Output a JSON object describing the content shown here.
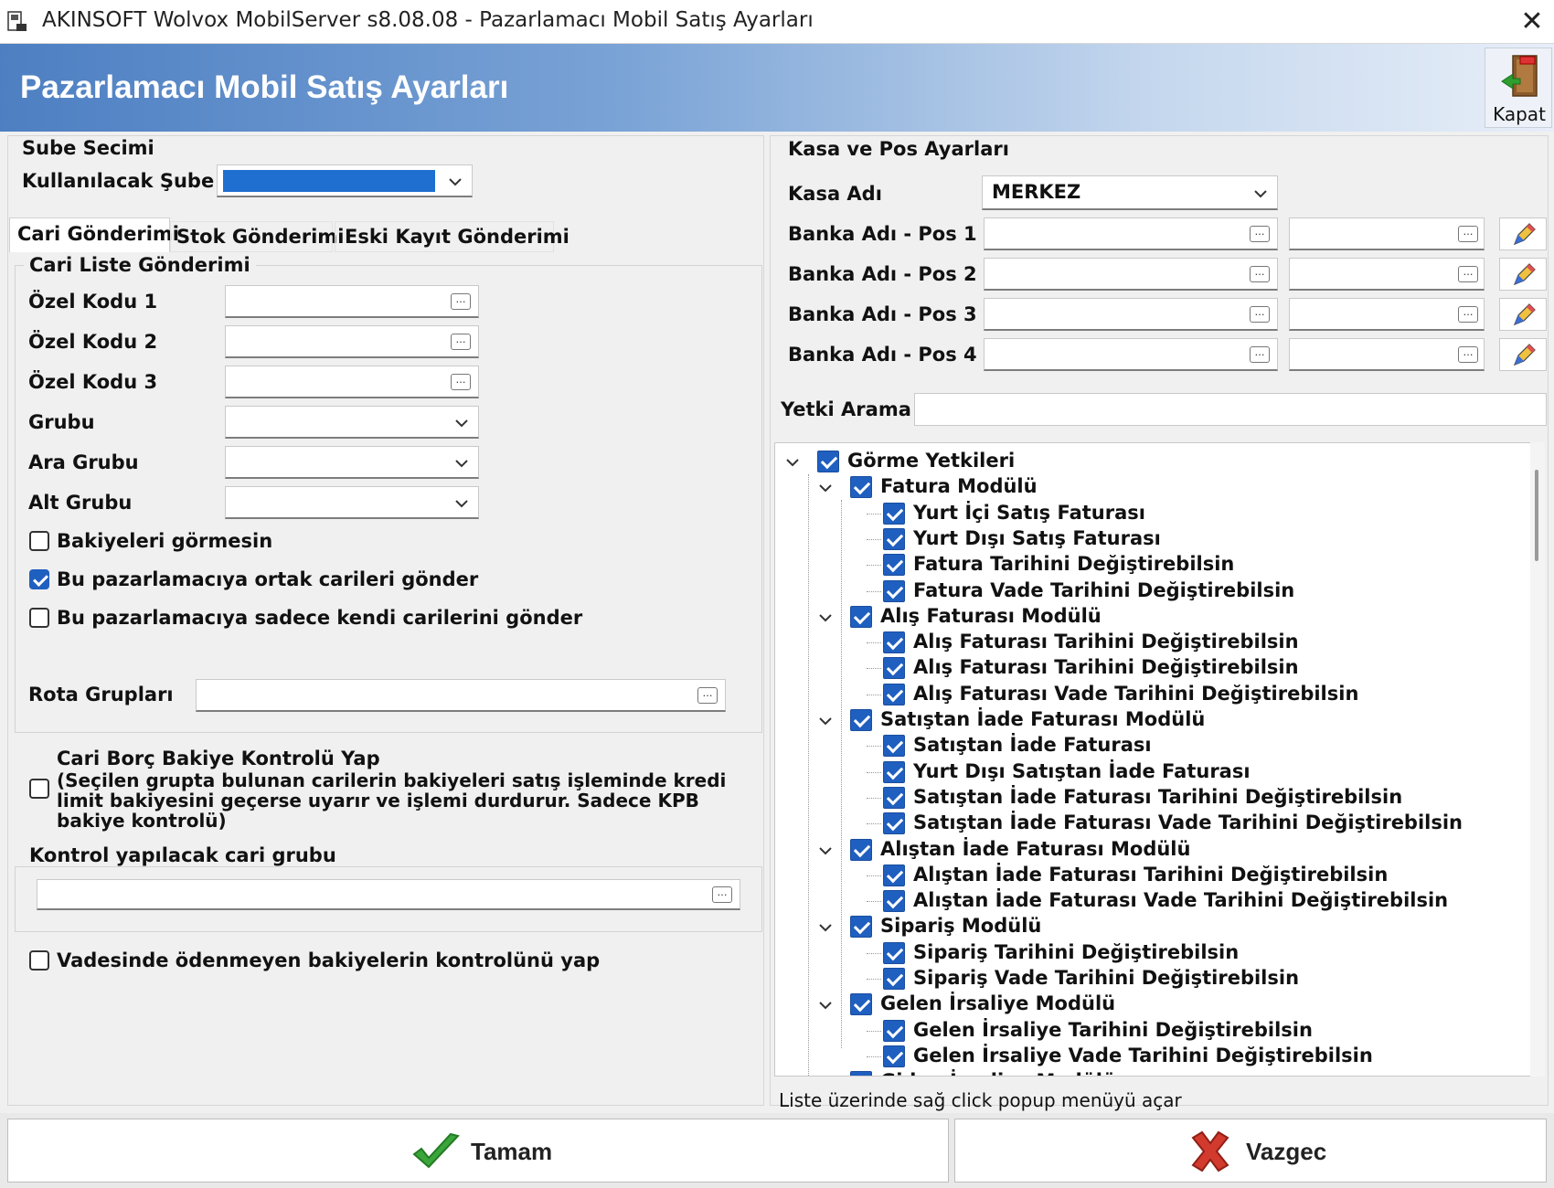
{
  "window": {
    "title": "AKINSOFT Wolvox MobilServer s8.08.08 - Pazarlamacı Mobil Satış Ayarları",
    "close_glyph": "✕"
  },
  "header": {
    "title": "Pazarlamacı Mobil Satış Ayarları",
    "close_button_label": "Kapat",
    "close_icon": "exit-door-icon"
  },
  "branch": {
    "section_title": "Sube Secimi",
    "label": "Kullanılacak Şube",
    "selected_value": ""
  },
  "tabs": [
    {
      "label": "Cari Gönderimi",
      "active": true
    },
    {
      "label": "Stok Gönderimi",
      "active": false
    },
    {
      "label": "Eski Kayıt Gönderimi",
      "active": false
    }
  ],
  "cari_list": {
    "group_title": "Cari Liste Gönderimi",
    "fields": [
      {
        "label": "Özel Kodu 1",
        "value": "",
        "kind": "lookup"
      },
      {
        "label": "Özel Kodu 2",
        "value": "",
        "kind": "lookup"
      },
      {
        "label": "Özel Kodu 3",
        "value": "",
        "kind": "lookup"
      },
      {
        "label": "Grubu",
        "value": "",
        "kind": "dropdown"
      },
      {
        "label": "Ara Grubu",
        "value": "",
        "kind": "dropdown"
      },
      {
        "label": "Alt Grubu",
        "value": "",
        "kind": "dropdown"
      }
    ],
    "checkboxes": [
      {
        "label": "Bakiyeleri görmesin",
        "checked": false
      },
      {
        "label": "Bu pazarlamacıya ortak carileri gönder",
        "checked": true
      },
      {
        "label": "Bu pazarlamacıya sadece kendi carilerini gönder",
        "checked": false
      }
    ],
    "route_label": "Rota Grupları",
    "route_value": ""
  },
  "debt_control": {
    "checked": false,
    "line1": "Cari Borç Bakiye Kontrolü Yap",
    "line2": "(Seçilen grupta bulunan carilerin bakiyeleri satış işleminde kredi",
    "line3": "limit bakiyesini geçerse uyarır ve işlemi durdurur. Sadece KPB",
    "line4": "bakiye kontrolü)",
    "group_title": "Kontrol yapılacak cari grubu",
    "group_value": ""
  },
  "overdue": {
    "label": "Vadesinde ödenmeyen bakiyelerin kontrolünü yap",
    "checked": false
  },
  "kasa_pos": {
    "section_title": "Kasa ve Pos Ayarları",
    "kasa_label": "Kasa Adı",
    "kasa_value": "MERKEZ",
    "pos_rows": [
      {
        "label": "Banka Adı - Pos 1",
        "bank": "",
        "pos": ""
      },
      {
        "label": "Banka Adı - Pos 2",
        "bank": "",
        "pos": ""
      },
      {
        "label": "Banka Adı - Pos 3",
        "bank": "",
        "pos": ""
      },
      {
        "label": "Banka Adı - Pos 4",
        "bank": "",
        "pos": ""
      }
    ]
  },
  "permission_search": {
    "label": "Yetki Arama",
    "value": ""
  },
  "tree": [
    {
      "level": 0,
      "label": "Görme Yetkileri",
      "expandable": true
    },
    {
      "level": 1,
      "label": "Fatura Modülü",
      "expandable": true
    },
    {
      "level": 2,
      "label": "Yurt İçi Satış Faturası"
    },
    {
      "level": 2,
      "label": "Yurt Dışı Satış Faturası"
    },
    {
      "level": 2,
      "label": "Fatura Tarihini Değiştirebilsin"
    },
    {
      "level": 2,
      "label": "Fatura Vade Tarihini Değiştirebilsin"
    },
    {
      "level": 1,
      "label": "Alış Faturası Modülü",
      "expandable": true
    },
    {
      "level": 2,
      "label": "Alış Faturası Tarihini Değiştirebilsin"
    },
    {
      "level": 2,
      "label": "Alış Faturası Tarihini Değiştirebilsin"
    },
    {
      "level": 2,
      "label": "Alış Faturası Vade Tarihini Değiştirebilsin"
    },
    {
      "level": 1,
      "label": "Satıştan İade Faturası Modülü",
      "expandable": true
    },
    {
      "level": 2,
      "label": "Satıştan İade Faturası"
    },
    {
      "level": 2,
      "label": "Yurt Dışı Satıştan İade Faturası"
    },
    {
      "level": 2,
      "label": "Satıştan İade Faturası Tarihini Değiştirebilsin"
    },
    {
      "level": 2,
      "label": "Satıştan İade Faturası Vade Tarihini Değiştirebilsin"
    },
    {
      "level": 1,
      "label": "Alıştan İade Faturası Modülü",
      "expandable": true
    },
    {
      "level": 2,
      "label": "Alıştan İade Faturası Tarihini Değiştirebilsin"
    },
    {
      "level": 2,
      "label": "Alıştan İade Faturası Vade Tarihini Değiştirebilsin"
    },
    {
      "level": 1,
      "label": "Sipariş Modülü",
      "expandable": true
    },
    {
      "level": 2,
      "label": "Sipariş Tarihini Değiştirebilsin"
    },
    {
      "level": 2,
      "label": "Sipariş Vade Tarihini Değiştirebilsin"
    },
    {
      "level": 1,
      "label": "Gelen İrsaliye Modülü",
      "expandable": true
    },
    {
      "level": 2,
      "label": "Gelen İrsaliye Tarihini Değiştirebilsin"
    },
    {
      "level": 2,
      "label": "Gelen İrsaliye Vade Tarihini Değiştirebilsin"
    },
    {
      "level": 1,
      "label": "Giden İrsaliye Modülü",
      "expandable": true
    }
  ],
  "status_hint": "Liste üzerinde sağ click popup menüyü açar",
  "buttons": {
    "ok": "Tamam",
    "cancel": "Vazgec"
  },
  "colors": {
    "accent": "#1f5fbf",
    "header_start": "#4d7fc2",
    "ok_green": "#3aa53a",
    "cancel_red": "#d23a2e"
  }
}
